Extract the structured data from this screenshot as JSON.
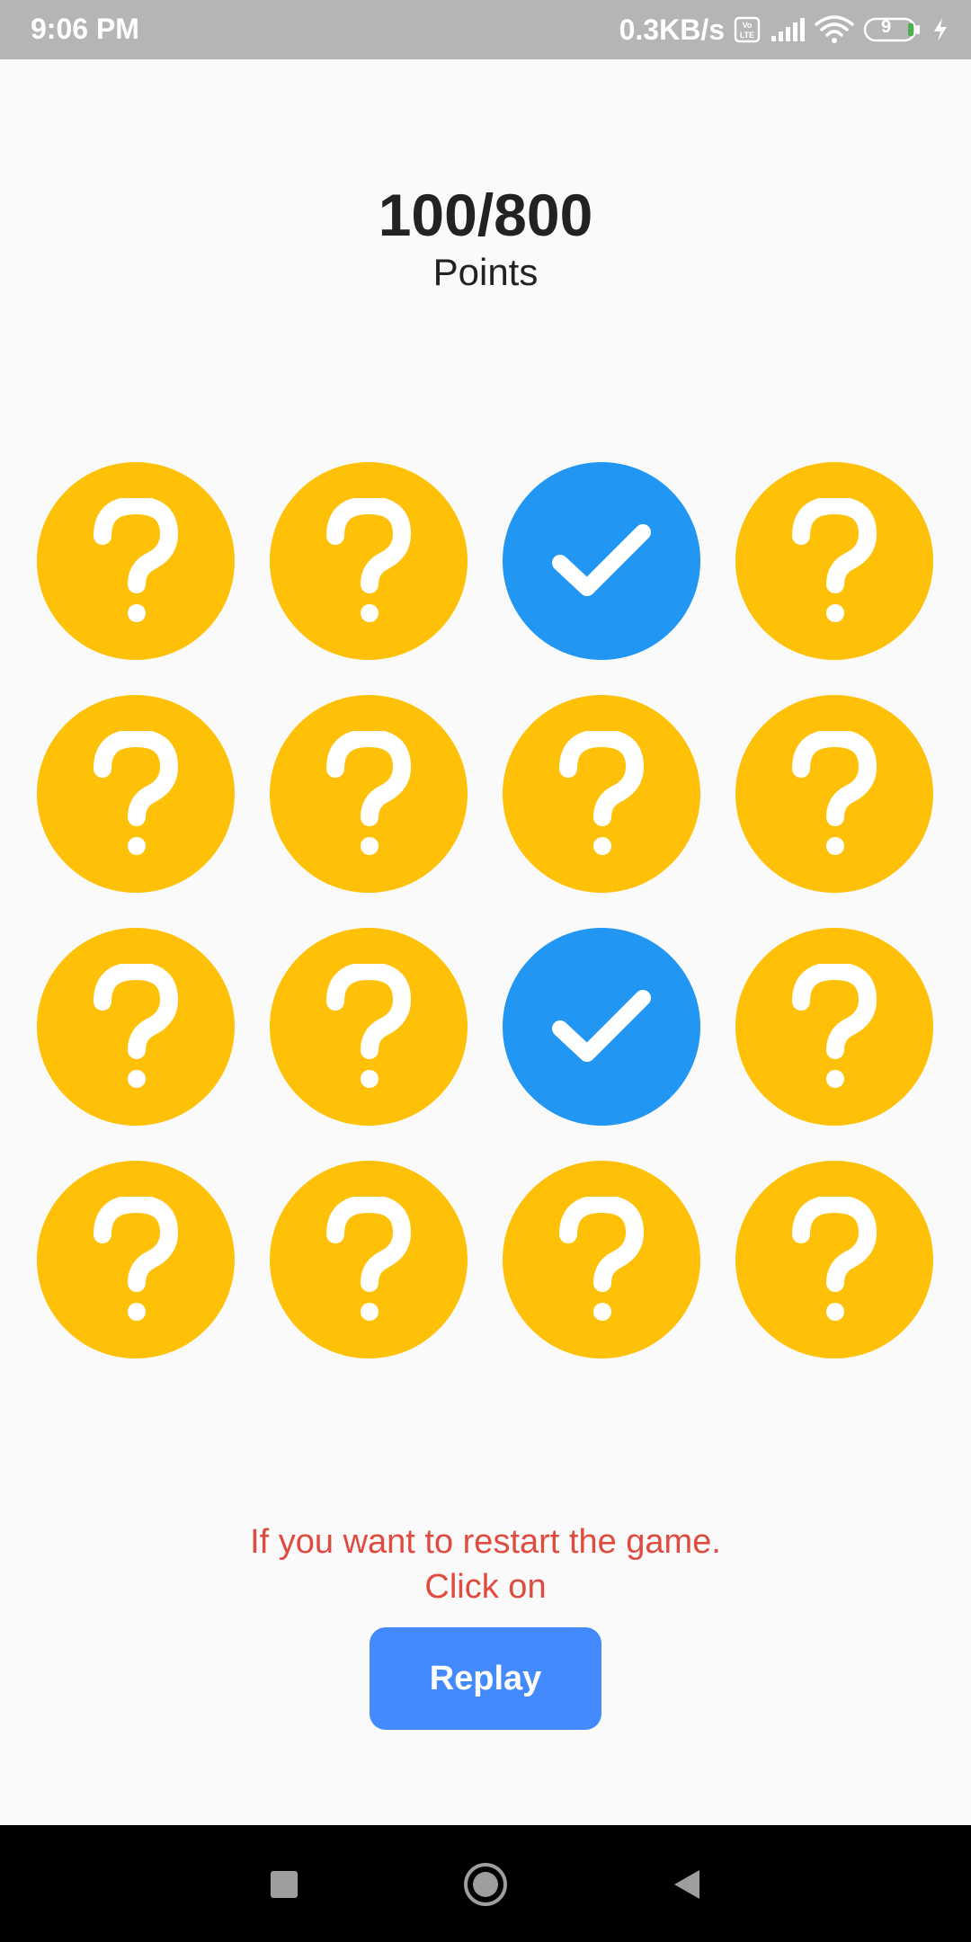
{
  "status_bar": {
    "time": "9:06 PM",
    "network_speed": "0.3KB/s",
    "battery_level": "9",
    "icons": [
      "volte-icon",
      "signal-icon",
      "wifi-icon",
      "battery-icon",
      "charging-icon"
    ]
  },
  "score": {
    "value": "100/800",
    "label": "Points"
  },
  "grid": {
    "rows": 4,
    "cols": 4,
    "tiles": [
      "hidden",
      "hidden",
      "found",
      "hidden",
      "hidden",
      "hidden",
      "hidden",
      "hidden",
      "hidden",
      "hidden",
      "found",
      "hidden",
      "hidden",
      "hidden",
      "hidden",
      "hidden"
    ],
    "colors": {
      "hidden": "#FFC107",
      "found": "#2196F3"
    },
    "icons": {
      "hidden": "question-mark-icon",
      "found": "check-icon"
    }
  },
  "restart": {
    "line1": "If you want to restart the game.",
    "line2": "Click on",
    "button_label": "Replay"
  },
  "nav_bar": {
    "icons": [
      "recent-apps-icon",
      "home-icon",
      "back-icon"
    ]
  }
}
